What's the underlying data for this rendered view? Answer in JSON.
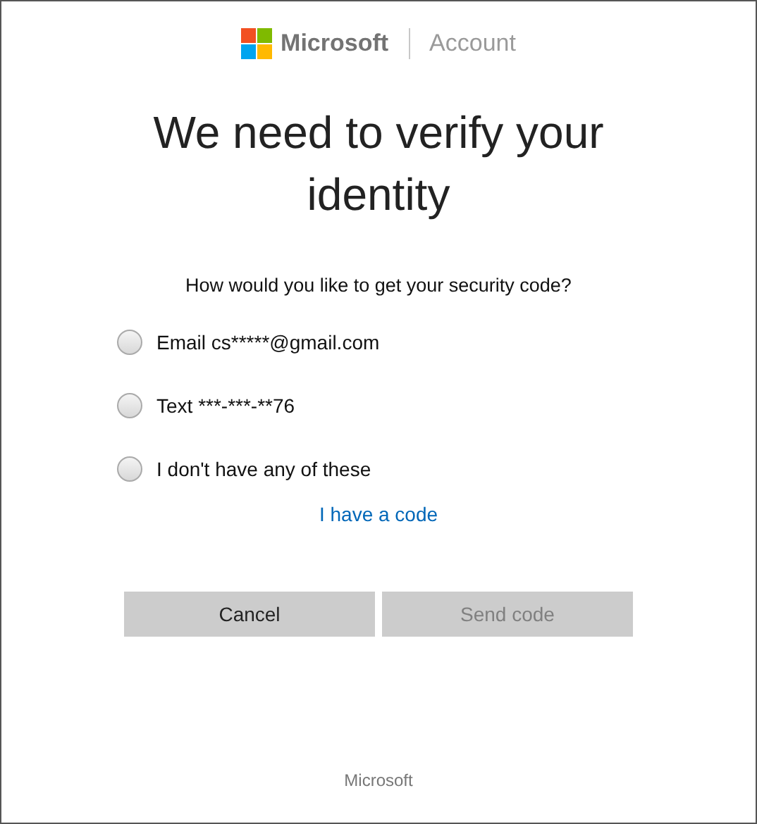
{
  "header": {
    "brand": "Microsoft",
    "section": "Account"
  },
  "title": "We need to verify your identity",
  "question": "How would you like to get your security code?",
  "options": [
    {
      "label": "Email cs*****@gmail.com",
      "selected": false
    },
    {
      "label": "Text ***-***-**76",
      "selected": false
    },
    {
      "label": "I don't have any of these",
      "selected": false
    }
  ],
  "link": "I have a code",
  "buttons": [
    {
      "label": "Cancel",
      "disabled": false
    },
    {
      "label": "Send code",
      "disabled": true
    }
  ],
  "footer": "Microsoft"
}
